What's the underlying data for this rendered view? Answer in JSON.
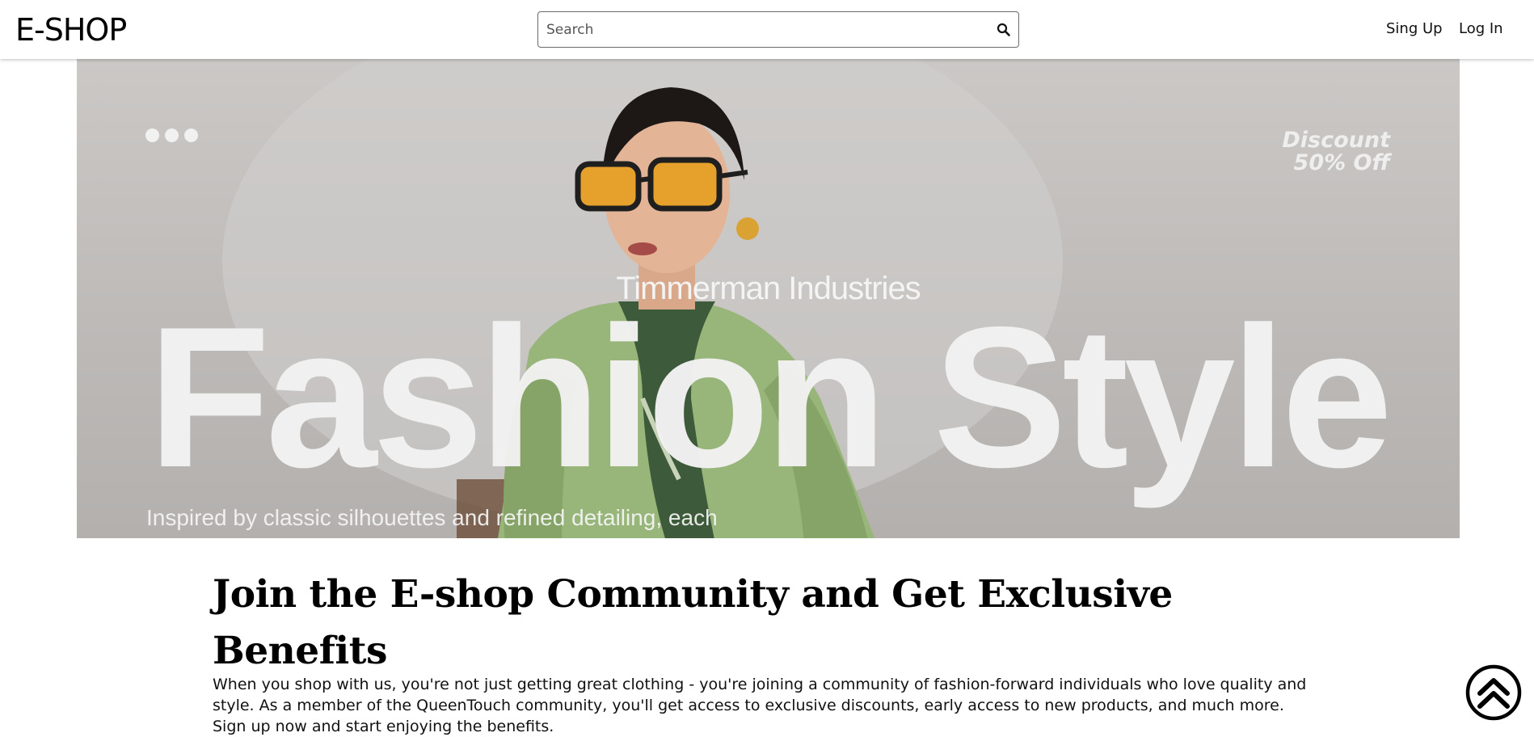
{
  "header": {
    "logo": "E-SHOP",
    "search": {
      "placeholder": "Search",
      "value": ""
    },
    "nav": {
      "signup_label": "Sing Up",
      "login_label": "Log In"
    }
  },
  "hero": {
    "discount_line1": "Discount",
    "discount_line2": "50% Off",
    "brand": "Timmerman Industries",
    "headline": "Fashion Style",
    "subtext": "Inspired by classic silhouettes and refined detailing, each"
  },
  "community": {
    "title": "Join the E-shop Community and Get Exclusive Benefits",
    "body": "When you shop with us, you're not just getting great clothing - you're joining a community of fashion-forward individuals who love quality and style. As a member of the QueenTouch community, you'll get access to exclusive discounts, early access to new products, and much more. Sign up now and start enjoying the benefits."
  },
  "icons": {
    "search": "search-icon",
    "scroll_top": "double-chevron-up-icon"
  }
}
